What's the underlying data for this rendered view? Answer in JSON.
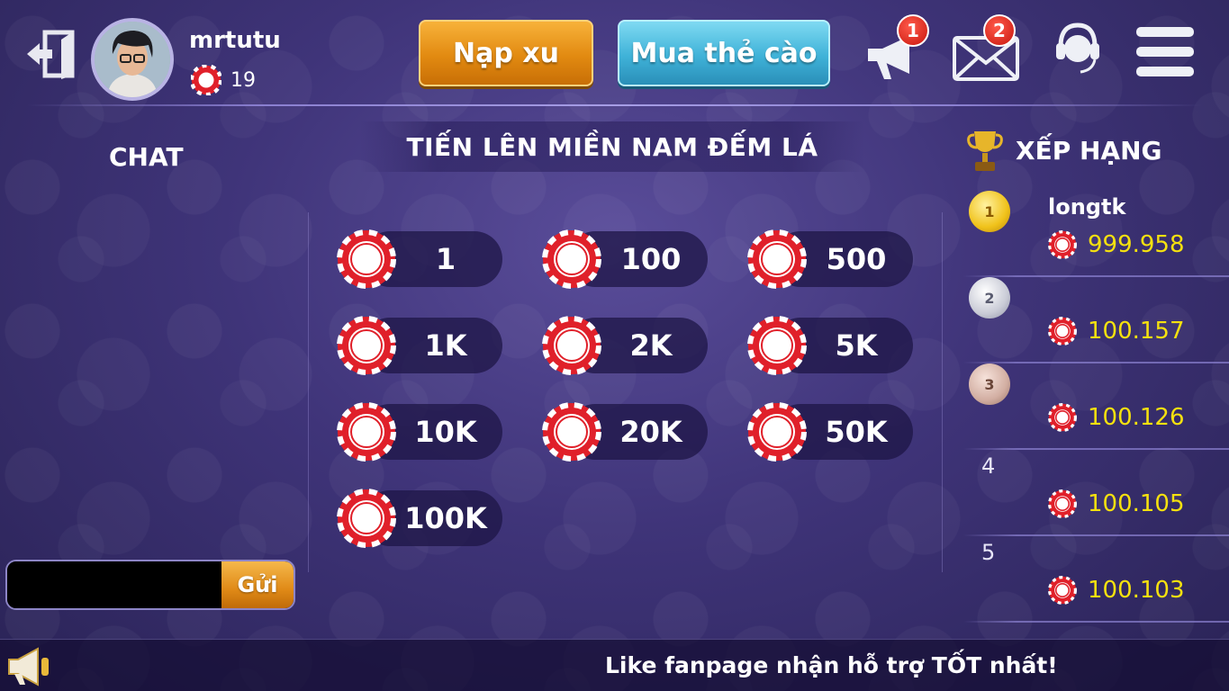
{
  "header": {
    "username": "mrtutu",
    "coins": "19",
    "nap_label": "Nạp xu",
    "mua_label": "Mua thẻ cào",
    "announcement_badge": "1",
    "mail_badge": "2"
  },
  "chat": {
    "title": "CHAT",
    "input_value": "",
    "send_label": "Gửi"
  },
  "game": {
    "title": "TIẾN LÊN MIỀN NAM ĐẾM LÁ",
    "bets": [
      "1",
      "100",
      "500",
      "1K",
      "2K",
      "5K",
      "10K",
      "20K",
      "50K",
      "100K"
    ]
  },
  "ranking": {
    "title": "XẾP HẠNG",
    "rows": [
      {
        "rank": "1",
        "name": "longtk",
        "value": "999.958"
      },
      {
        "rank": "2",
        "name": "",
        "value": "100.157"
      },
      {
        "rank": "3",
        "name": "",
        "value": "100.126"
      },
      {
        "rank": "4",
        "name": "",
        "value": "100.105"
      },
      {
        "rank": "5",
        "name": "",
        "value": "100.103"
      }
    ]
  },
  "footer": {
    "marquee": "Like fanpage nhận hỗ trợ TỐT nhất!"
  },
  "colors": {
    "background": "#3f3479",
    "chip_red": "#e0202a",
    "nap_button": "#e28a11",
    "mua_button": "#3fb2d8",
    "rank_value": "#f5e10f"
  },
  "icons": [
    "exit-icon",
    "coin-chip-icon",
    "megaphone-icon",
    "mail-icon",
    "headset-icon",
    "menu-icon",
    "trophy-icon",
    "speaker-icon"
  ]
}
